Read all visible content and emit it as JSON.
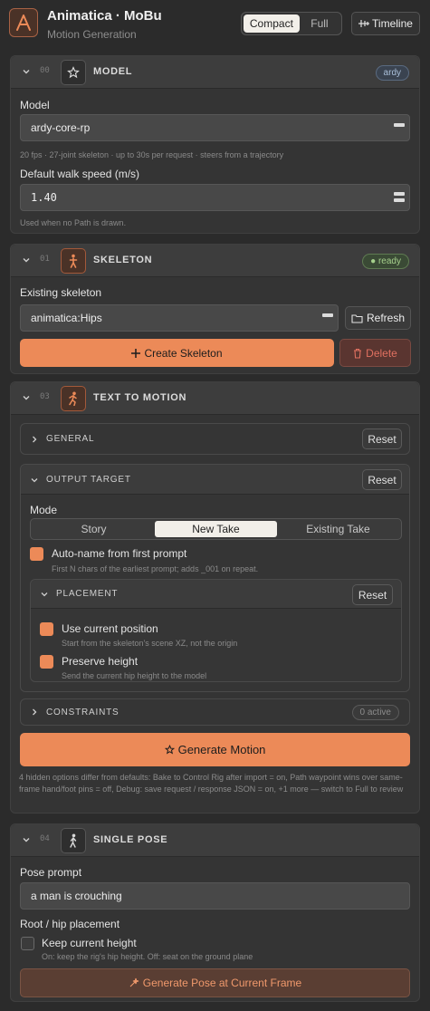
{
  "header": {
    "title": "Animatica · MoBu",
    "subtitle": "Motion Generation",
    "view_modes": [
      "Compact",
      "Full"
    ],
    "active_view": "Compact",
    "timeline_label": "Timeline"
  },
  "model": {
    "number": "00",
    "title": "MODEL",
    "badge": "ardy",
    "model_label": "Model",
    "model_value": "ardy-core-rp",
    "model_info": "20 fps · 27-joint skeleton · up to 30s per request · steers from a trajectory",
    "speed_label": "Default walk speed (m/s)",
    "speed_value": "1.40",
    "speed_hint": "Used when no Path is drawn."
  },
  "skeleton": {
    "number": "01",
    "title": "SKELETON",
    "badge": "● ready",
    "existing_label": "Existing skeleton",
    "existing_value": "animatica:Hips",
    "refresh_label": "Refresh",
    "create_label": "Create Skeleton",
    "delete_label": "Delete"
  },
  "text_to_motion": {
    "number": "03",
    "title": "TEXT TO MOTION",
    "general": {
      "title": "GENERAL",
      "reset": "Reset"
    },
    "output_target": {
      "title": "OUTPUT TARGET",
      "reset": "Reset",
      "mode_label": "Mode",
      "modes": [
        "Story",
        "New Take",
        "Existing Take"
      ],
      "active_mode": "New Take",
      "autoname_label": "Auto-name from first prompt",
      "autoname_hint": "First N chars of the earliest prompt; adds _001 on repeat.",
      "autoname_checked": true
    },
    "placement": {
      "title": "PLACEMENT",
      "reset": "Reset",
      "use_current_label": "Use current position",
      "use_current_hint": "Start from the skeleton's scene XZ, not the origin",
      "use_current_checked": true,
      "preserve_label": "Preserve height",
      "preserve_hint": "Send the current hip height to the model",
      "preserve_checked": true
    },
    "constraints": {
      "title": "CONSTRAINTS",
      "badge": "0 active"
    },
    "generate_label": "Generate Motion",
    "note": "4 hidden options differ from defaults: Bake to Control Rig after import = on, Path waypoint wins over same-frame hand/foot pins = off, Debug: save request / response JSON = on, +1 more — switch to Full to review"
  },
  "single_pose": {
    "number": "04",
    "title": "SINGLE POSE",
    "prompt_label": "Pose prompt",
    "prompt_value": "a man is crouching",
    "root_label": "Root / hip placement",
    "keep_label": "Keep current height",
    "keep_hint": "On: keep the rig's hip height. Off: seat on the ground plane",
    "keep_checked": false,
    "generate_label": "Generate Pose at Current Frame"
  },
  "colors": {
    "accent": "#ec8a58",
    "background": "#2b2b2b",
    "panel": "#343434"
  }
}
